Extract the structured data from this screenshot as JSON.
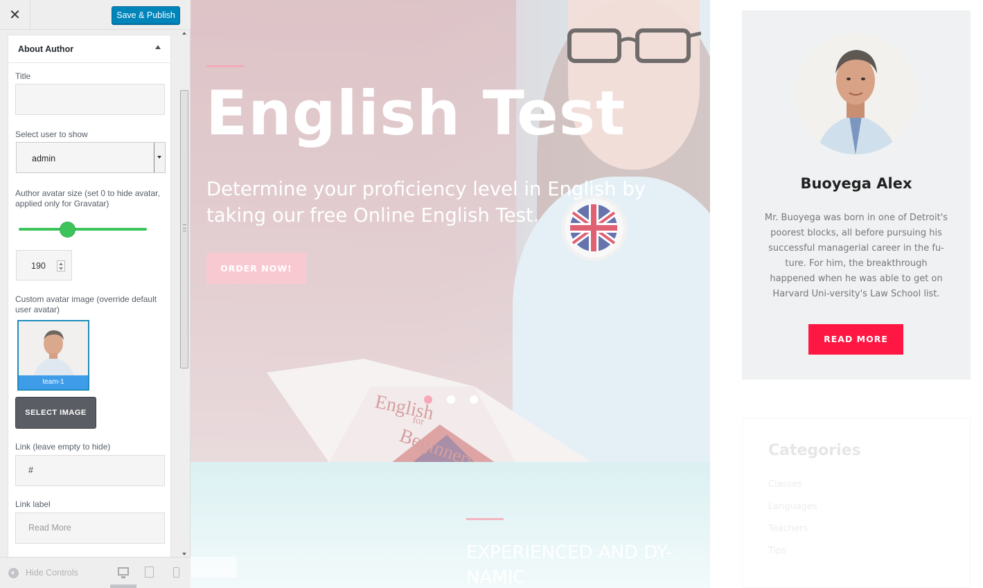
{
  "header": {
    "close_glyph": "✕",
    "publish_label": "Save & Publish"
  },
  "panel": {
    "title": "About Author",
    "title_field_label": "Title",
    "title_field_value": "",
    "user_label": "Select user to show",
    "user_value": "admin",
    "avatar_size_label": "Author avatar size (set 0 to hide avatar, applied only for Gravatar)",
    "avatar_size_slider_fraction": 0.38,
    "avatar_size_value": "190",
    "custom_avatar_label": "Custom avatar image (override default user avatar)",
    "image_caption": "team-1",
    "select_image_label": "SELECT IMAGE",
    "link_label": "Link (leave empty to hide)",
    "link_value": "#",
    "link_text_label": "Link label",
    "link_text_placeholder": "Read More"
  },
  "footer": {
    "hide_controls_label": "Hide Controls",
    "icons": [
      "desktop-icon",
      "tablet-icon",
      "mobile-icon"
    ]
  },
  "hero": {
    "title": "English Test",
    "subtitle": "Determine your proficiency level in English by taking our free Online English Test.",
    "button_label": "ORDER NOW!",
    "slide_count": 3,
    "active_slide": 1,
    "book_title_line1": "English",
    "book_title_line2": "for",
    "book_title_line3": "Beginners"
  },
  "section2": {
    "title": "EXPERIENCED AND DY-NAMIC"
  },
  "author": {
    "name": "Buoyega Alex",
    "bio": "Mr. Buoyega was born in one of Detroit's poorest blocks, all before pursuing his successful managerial career in the fu-ture. For him, the breakthrough happened when he was able to get on Harvard Uni-versity's Law School list.",
    "button_label": "READ MORE"
  },
  "categories": {
    "title": "Categories",
    "items": [
      "Classes",
      "Languages",
      "Teachers",
      "Tips"
    ]
  },
  "colors": {
    "publish": "#0085ba",
    "slider": "#3cc45a",
    "read_more": "#ff1744",
    "hero_button": "#f9c9d2"
  }
}
